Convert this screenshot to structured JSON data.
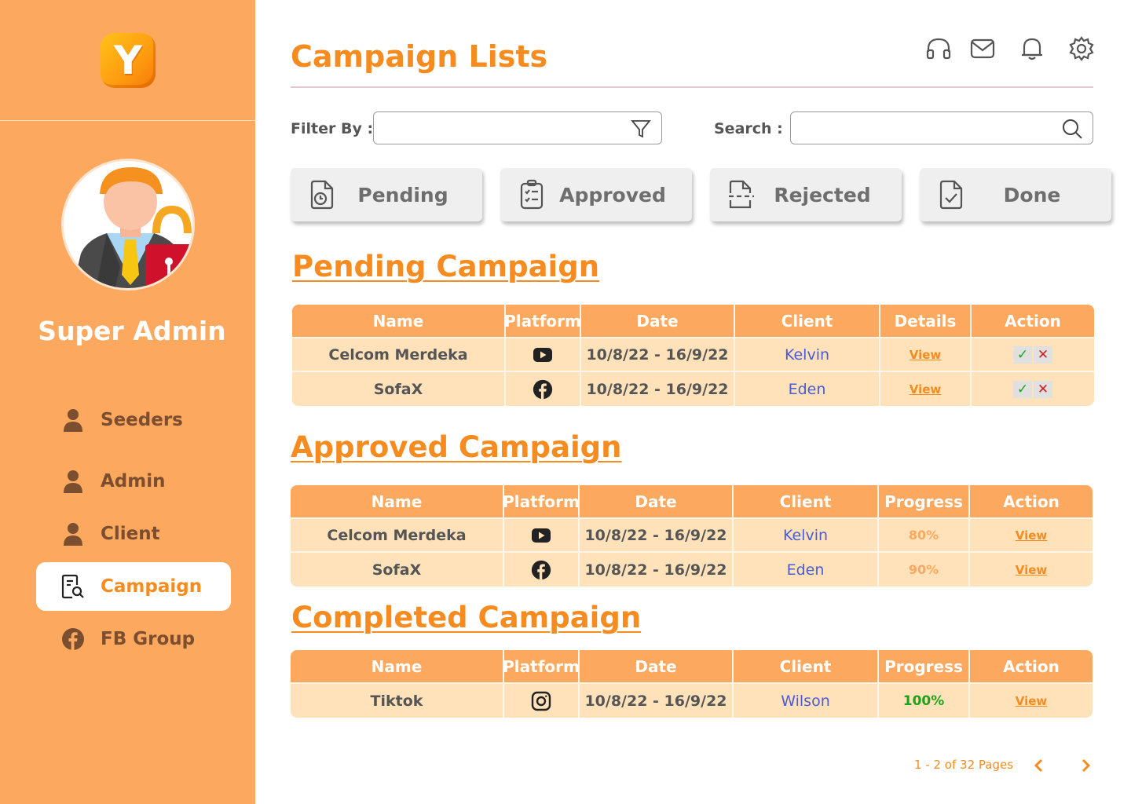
{
  "app": {
    "logo_letter": "Y"
  },
  "sidebar": {
    "role": "Super Admin",
    "items": [
      {
        "label": "Seeders",
        "icon": "user-icon"
      },
      {
        "label": "Admin",
        "icon": "user-icon"
      },
      {
        "label": "Client",
        "icon": "user-icon"
      },
      {
        "label": "Campaign",
        "icon": "document-search-icon",
        "active": true
      },
      {
        "label": "FB Group",
        "icon": "facebook-icon"
      }
    ]
  },
  "header": {
    "title": "Campaign Lists",
    "icons": [
      "headset-icon",
      "mail-icon",
      "bell-icon",
      "gear-icon"
    ]
  },
  "filters": {
    "filter_label": "Filter By :",
    "filter_value": "",
    "search_label": "Search :",
    "search_value": ""
  },
  "status_buttons": [
    "Pending",
    "Approved",
    "Rejected",
    "Done"
  ],
  "pending": {
    "title": "Pending Campaign",
    "columns": [
      "Name",
      "Platform",
      "Date",
      "Client",
      "Details",
      "Action"
    ],
    "rows": [
      {
        "name": "Celcom Merdeka",
        "platform": "youtube-icon",
        "date": "10/8/22 - 16/9/22",
        "client": "Kelvin",
        "details": "View",
        "approve": "✓",
        "reject": "✕"
      },
      {
        "name": "SofaX",
        "platform": "facebook-icon",
        "date": "10/8/22 - 16/9/22",
        "client": "Eden",
        "details": "View",
        "approve": "✓",
        "reject": "✕"
      }
    ]
  },
  "approved": {
    "title": "Approved Campaign",
    "columns": [
      "Name",
      "Platform",
      "Date",
      "Client",
      "Progress",
      "Action"
    ],
    "rows": [
      {
        "name": "Celcom Merdeka",
        "platform": "youtube-icon",
        "date": "10/8/22 - 16/9/22",
        "client": "Kelvin",
        "progress": "80%",
        "action": "View"
      },
      {
        "name": "SofaX",
        "platform": "facebook-icon",
        "date": "10/8/22 - 16/9/22",
        "client": "Eden",
        "progress": "90%",
        "action": "View"
      }
    ]
  },
  "completed": {
    "title": "Completed Campaign",
    "columns": [
      "Name",
      "Platform",
      "Date",
      "Client",
      "Progress",
      "Action"
    ],
    "rows": [
      {
        "name": "Tiktok",
        "platform": "instagram-icon",
        "date": "10/8/22 - 16/9/22",
        "client": "Wilson",
        "progress": "100%",
        "action": "View"
      }
    ]
  },
  "pagination": {
    "text": "1 - 2 of 32 Pages"
  },
  "colors": {
    "primary": "#F68B1F",
    "sidebar": "#FCA85E",
    "row": "#FFE2BA",
    "link": "#4A5BD6",
    "success": "#1AA31A",
    "danger": "#D41E1E"
  }
}
